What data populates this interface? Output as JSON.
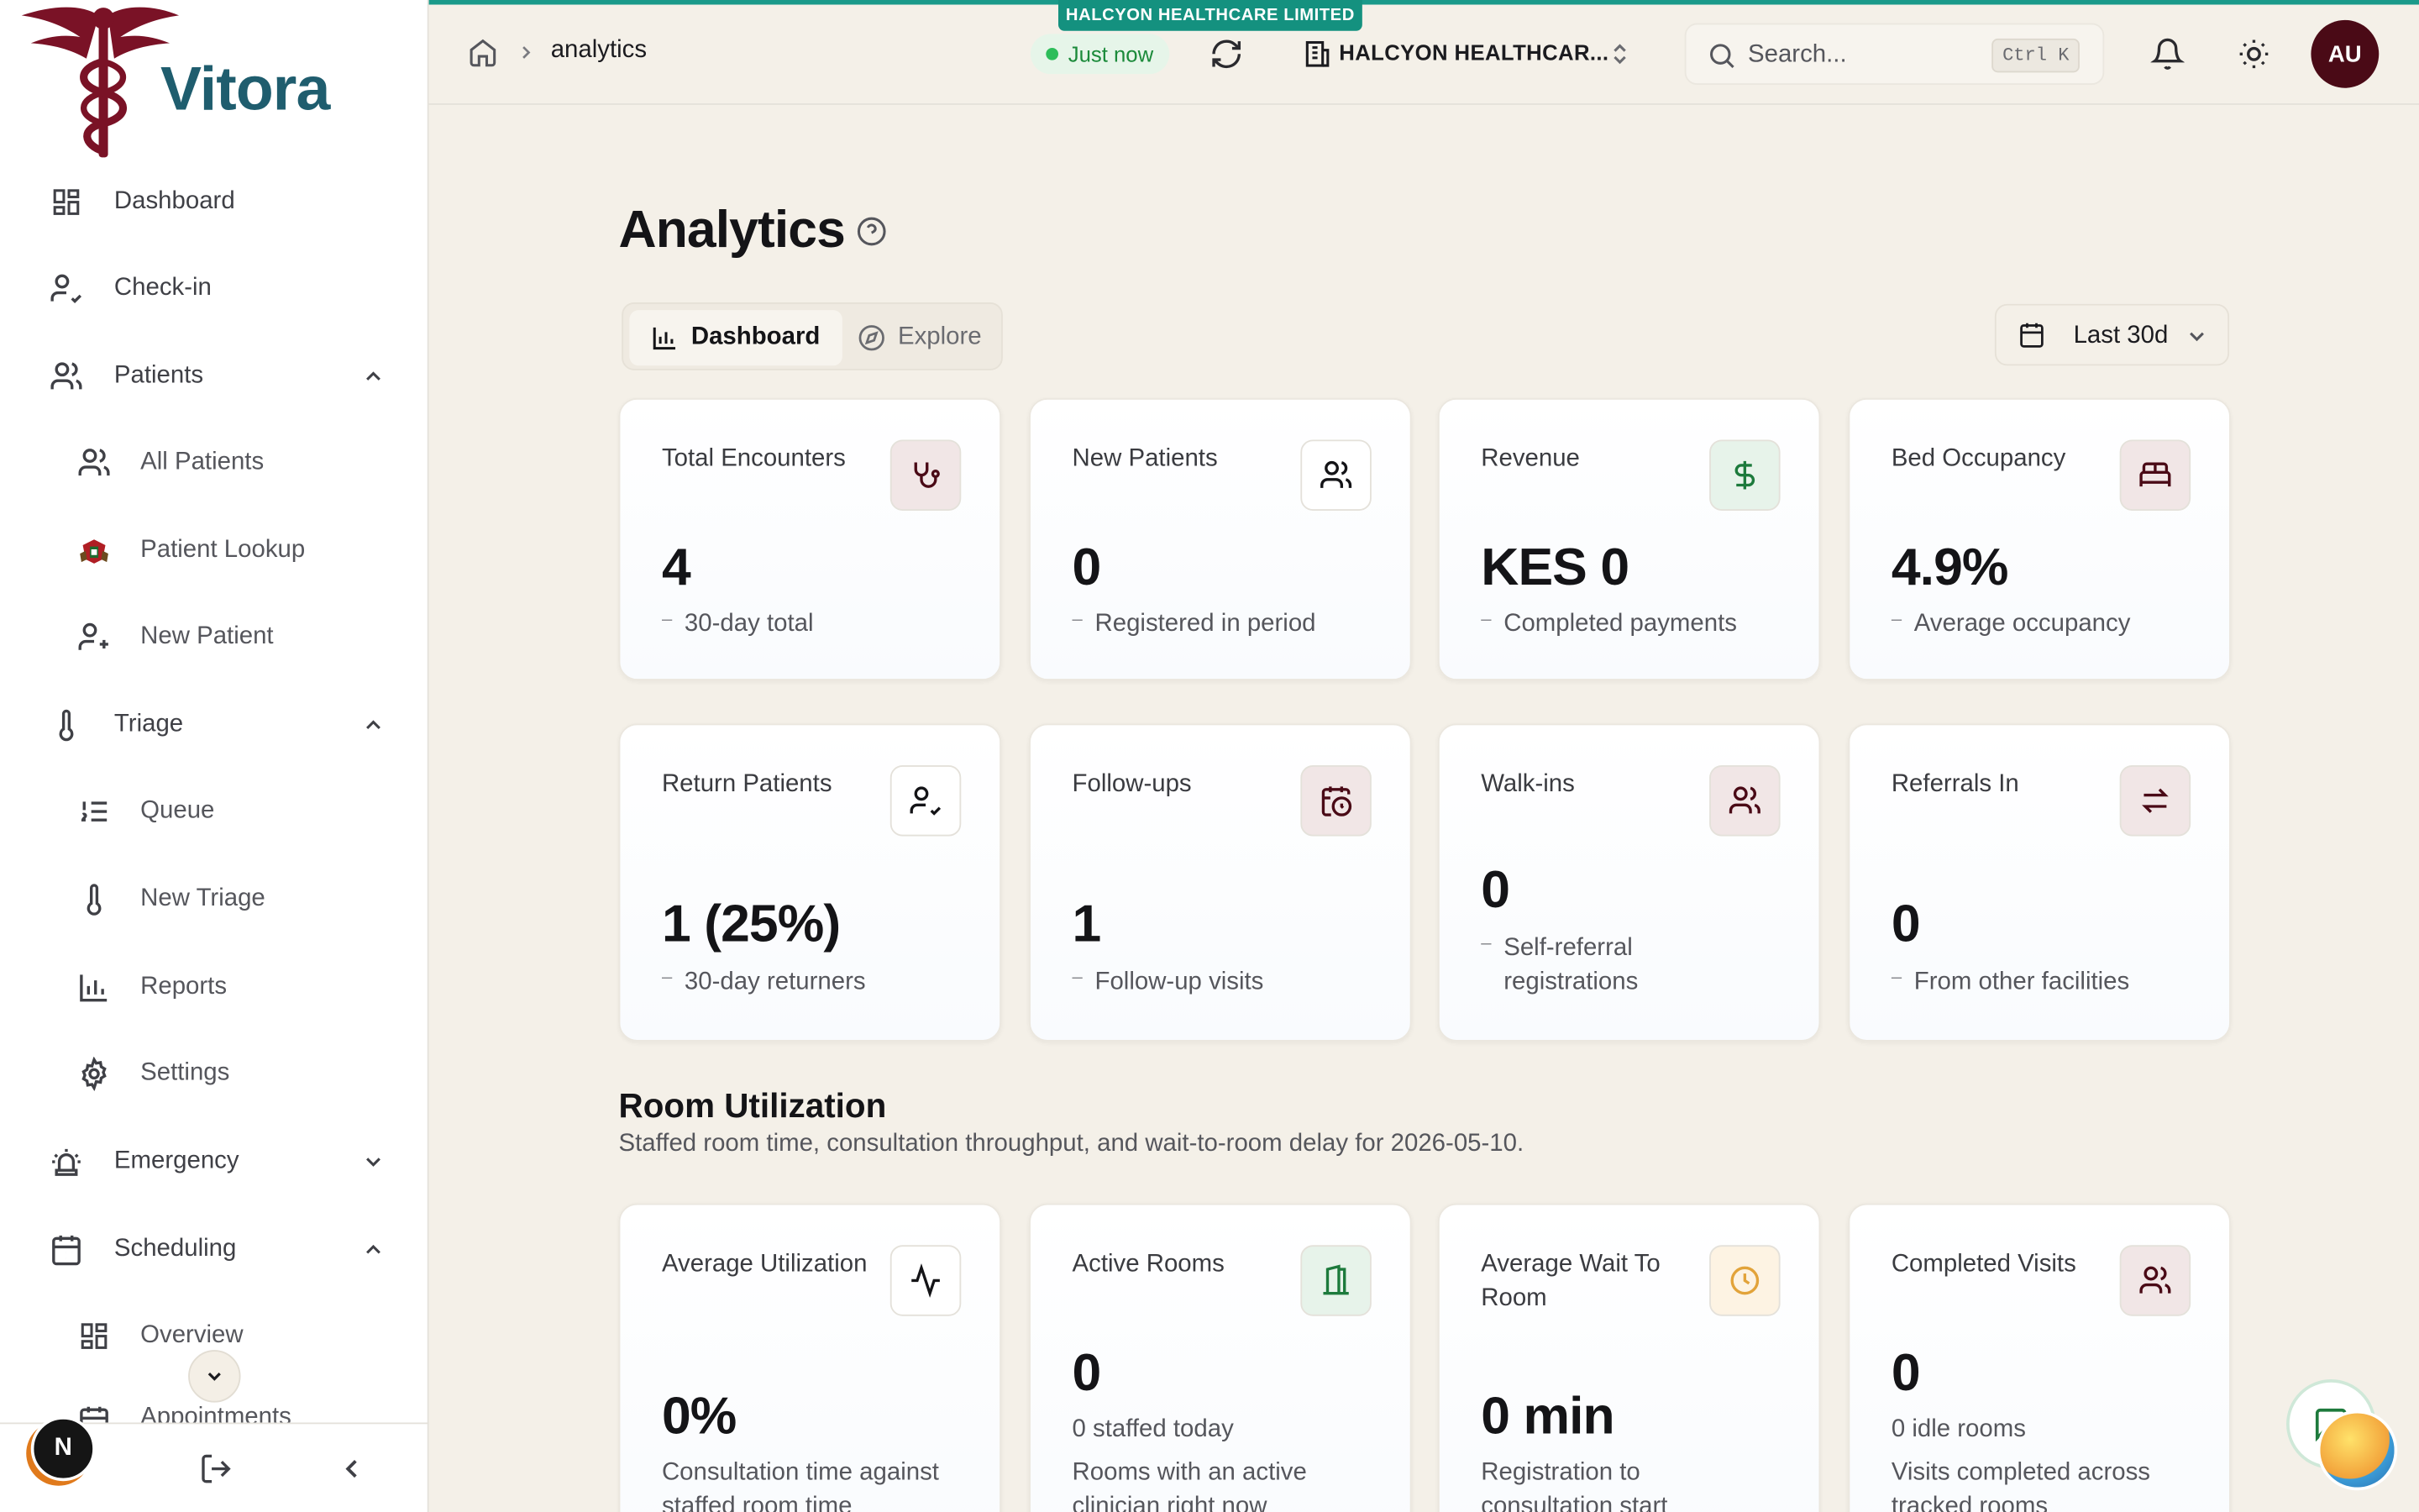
{
  "brand": {
    "name": "Vitora"
  },
  "org_banner": "HALCYON HEALTHCARE LIMITED",
  "breadcrumb": {
    "current": "analytics"
  },
  "status": "Just now",
  "org_selector": {
    "label": "HALCYON HEALTHCAR..."
  },
  "search": {
    "placeholder": "Search...",
    "shortcut": "Ctrl K"
  },
  "user": {
    "initials": "AU"
  },
  "sidebar": {
    "items": [
      {
        "label": "Dashboard",
        "icon": "layout-dashboard-icon",
        "level": "top"
      },
      {
        "label": "Check-in",
        "icon": "user-check-icon",
        "level": "top"
      },
      {
        "label": "Patients",
        "icon": "users-icon",
        "level": "top",
        "expanded": true
      },
      {
        "label": "All Patients",
        "icon": "users-icon",
        "level": "sub"
      },
      {
        "label": "Patient Lookup",
        "icon": "kenya-emblem-icon",
        "level": "sub"
      },
      {
        "label": "New Patient",
        "icon": "user-plus-icon",
        "level": "sub"
      },
      {
        "label": "Triage",
        "icon": "thermometer-icon",
        "level": "top",
        "expanded": true
      },
      {
        "label": "Queue",
        "icon": "list-ordered-icon",
        "level": "sub"
      },
      {
        "label": "New Triage",
        "icon": "thermometer-icon",
        "level": "sub"
      },
      {
        "label": "Reports",
        "icon": "bar-chart-icon",
        "level": "sub"
      },
      {
        "label": "Settings",
        "icon": "gear-icon",
        "level": "sub"
      },
      {
        "label": "Emergency",
        "icon": "siren-icon",
        "level": "top",
        "expanded": false
      },
      {
        "label": "Scheduling",
        "icon": "calendar-icon",
        "level": "top",
        "expanded": true
      },
      {
        "label": "Overview",
        "icon": "layout-dashboard-icon",
        "level": "sub"
      },
      {
        "label": "Appointments",
        "icon": "calendar-icon",
        "level": "sub"
      }
    ],
    "footer_avatar": "N"
  },
  "page": {
    "title": "Analytics",
    "tabs": [
      {
        "label": "Dashboard",
        "active": true
      },
      {
        "label": "Explore",
        "active": false
      }
    ],
    "range": "Last 30d"
  },
  "kpi_cards": [
    {
      "title": "Total Encounters",
      "value": "4",
      "sub": "30-day total",
      "icon": "stethoscope-icon",
      "tone": "maroon"
    },
    {
      "title": "New Patients",
      "value": "0",
      "sub": "Registered in period",
      "icon": "users-icon",
      "tone": "white"
    },
    {
      "title": "Revenue",
      "value": "KES 0",
      "sub": "Completed payments",
      "icon": "dollar-icon",
      "tone": "green"
    },
    {
      "title": "Bed Occupancy",
      "value": "4.9%",
      "sub": "Average occupancy",
      "icon": "bed-icon",
      "tone": "maroon"
    },
    {
      "title": "Return Patients",
      "value": "1 (25%)",
      "sub": "30-day returners",
      "icon": "user-check-icon",
      "tone": "white"
    },
    {
      "title": "Follow-ups",
      "value": "1",
      "sub": "Follow-up visits",
      "icon": "calendar-clock-icon",
      "tone": "maroon"
    },
    {
      "title": "Walk-ins",
      "value": "0",
      "sub": "Self-referral registrations",
      "icon": "users-icon",
      "tone": "maroon"
    },
    {
      "title": "Referrals In",
      "value": "0",
      "sub": "From other facilities",
      "icon": "arrows-exchange-icon",
      "tone": "maroon"
    }
  ],
  "room_utilization": {
    "title": "Room Utilization",
    "subtitle": "Staffed room time, consultation throughput, and wait-to-room delay for 2026-05-10.",
    "cards": [
      {
        "title": "Average Utilization",
        "value": "0%",
        "sub": "Consultation time against staffed room time",
        "icon": "activity-icon",
        "tone": "white"
      },
      {
        "title": "Active Rooms",
        "value": "0",
        "line1": "0 staffed today",
        "sub": "Rooms with an active clinician right now",
        "icon": "door-icon",
        "tone": "green"
      },
      {
        "title": "Average Wait To Room",
        "value": "0 min",
        "sub": "Registration to consultation start",
        "icon": "clock-icon",
        "tone": "amber"
      },
      {
        "title": "Completed Visits",
        "value": "0",
        "line1": "0 idle rooms",
        "sub": "Visits completed across tracked rooms",
        "icon": "users-icon",
        "tone": "maroon"
      }
    ]
  }
}
